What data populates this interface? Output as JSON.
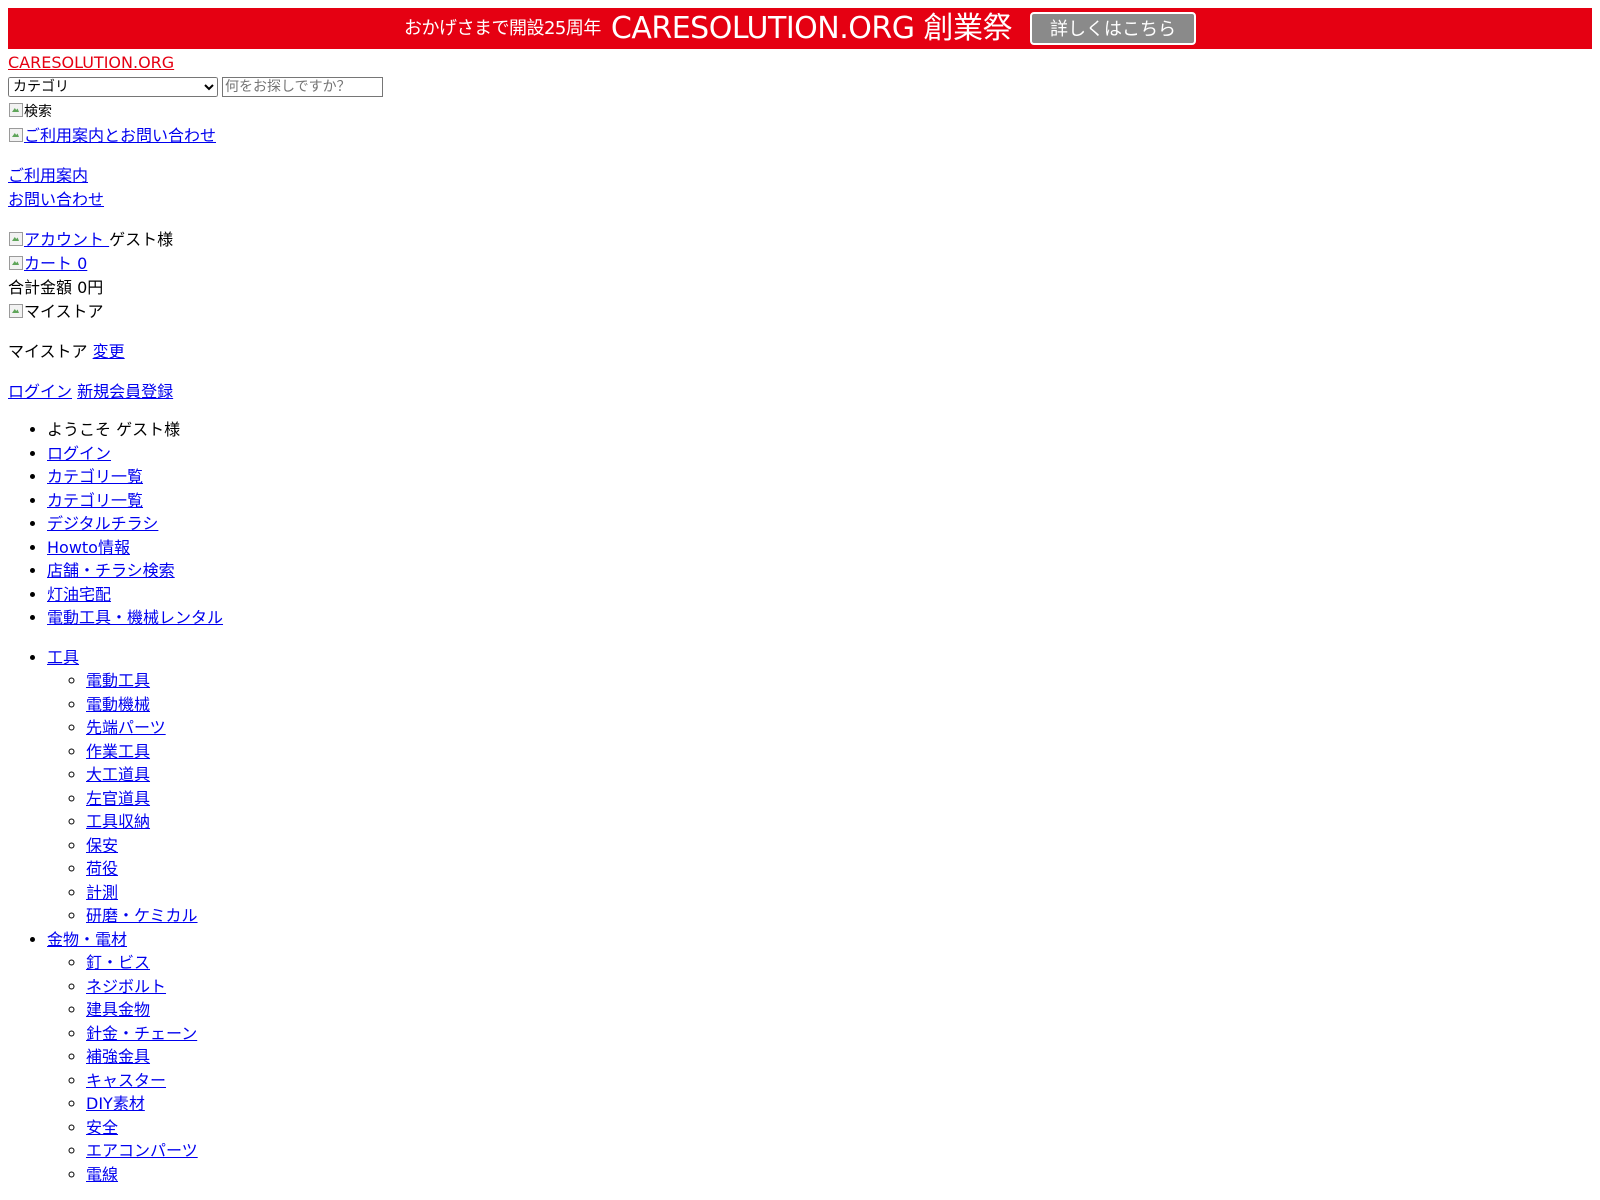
{
  "banner": {
    "small_text": "おかげさまで開設25周年",
    "big_text": "CARESOLUTION.ORG 創業祭",
    "button_label": "詳しくはこちら"
  },
  "header": {
    "logo_text": "CARESOLUTION.ORG",
    "category_select_value": "カテゴリ",
    "search_placeholder": "何をお探しですか？",
    "search_alt": "検索",
    "guide_contact_alt": "ご利用案内とお問い合わせ",
    "guide_link": "ご利用案内",
    "contact_link": "お問い合わせ",
    "account_alt": "アカウント",
    "guest_label": "ゲスト様",
    "cart_alt": "カート",
    "cart_count": "0",
    "total_label": "合計金額 0円",
    "mystore_alt": "マイストア",
    "mystore_label": "マイストア",
    "mystore_change": "変更",
    "login": "ログイン",
    "register": "新規会員登録"
  },
  "menu": {
    "welcome": "ようこそ ゲスト様",
    "items": [
      "ログイン",
      "カテゴリ一覧",
      "カテゴリ一覧",
      "デジタルチラシ",
      "Howto情報",
      "店舗・チラシ検索",
      "灯油宅配",
      "電動工具・機械レンタル"
    ]
  },
  "categories": [
    {
      "label": "工具",
      "children": [
        "電動工具",
        "電動機械",
        "先端パーツ",
        "作業工具",
        "大工道具",
        "左官道具",
        "工具収納",
        "保安",
        "荷役",
        "計測",
        "研磨・ケミカル"
      ]
    },
    {
      "label": "金物・電材",
      "children": [
        "釘・ビス",
        "ネジボルト",
        "建具金物",
        "針金・チェーン",
        "補強金具",
        "キャスター",
        "DIY素材",
        "安全",
        "エアコンパーツ",
        "電線"
      ]
    }
  ],
  "colors": {
    "banner_bg": "#e50012",
    "banner_button_bg": "#8a8a8a",
    "logo": "#e50012",
    "link": "#0000ee"
  }
}
